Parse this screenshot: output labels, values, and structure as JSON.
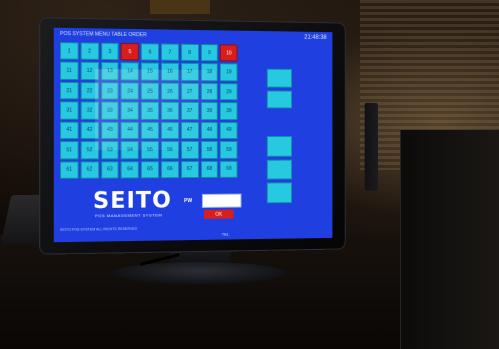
{
  "screen": {
    "topbar_left": "POS SYSTEM  MENU  TABLE  ORDER",
    "topbar_right": "21:48:38",
    "tables": [
      {
        "label": "1",
        "state": "free"
      },
      {
        "label": "2",
        "state": "free"
      },
      {
        "label": "3",
        "state": "free"
      },
      {
        "label": "5",
        "state": "occupied"
      },
      {
        "label": "6",
        "state": "free"
      },
      {
        "label": "7",
        "state": "free"
      },
      {
        "label": "8",
        "state": "free"
      },
      {
        "label": "9",
        "state": "free"
      },
      {
        "label": "10",
        "state": "occupied"
      },
      {
        "label": "",
        "state": "empty"
      },
      {
        "label": "11",
        "state": "free"
      },
      {
        "label": "12",
        "state": "free"
      },
      {
        "label": "13",
        "state": "free"
      },
      {
        "label": "14",
        "state": "free"
      },
      {
        "label": "15",
        "state": "free"
      },
      {
        "label": "16",
        "state": "free"
      },
      {
        "label": "17",
        "state": "free"
      },
      {
        "label": "18",
        "state": "free"
      },
      {
        "label": "19",
        "state": "free"
      },
      {
        "label": "",
        "state": "empty"
      },
      {
        "label": "21",
        "state": "free"
      },
      {
        "label": "22",
        "state": "free"
      },
      {
        "label": "23",
        "state": "free"
      },
      {
        "label": "24",
        "state": "free"
      },
      {
        "label": "25",
        "state": "free"
      },
      {
        "label": "26",
        "state": "free"
      },
      {
        "label": "27",
        "state": "free"
      },
      {
        "label": "28",
        "state": "free"
      },
      {
        "label": "29",
        "state": "free"
      },
      {
        "label": "",
        "state": "empty"
      },
      {
        "label": "31",
        "state": "free"
      },
      {
        "label": "32",
        "state": "free"
      },
      {
        "label": "33",
        "state": "free"
      },
      {
        "label": "34",
        "state": "free"
      },
      {
        "label": "35",
        "state": "free"
      },
      {
        "label": "36",
        "state": "free"
      },
      {
        "label": "37",
        "state": "free"
      },
      {
        "label": "38",
        "state": "free"
      },
      {
        "label": "39",
        "state": "free"
      },
      {
        "label": "",
        "state": "empty"
      },
      {
        "label": "41",
        "state": "free"
      },
      {
        "label": "42",
        "state": "free"
      },
      {
        "label": "43",
        "state": "free"
      },
      {
        "label": "44",
        "state": "free"
      },
      {
        "label": "45",
        "state": "free"
      },
      {
        "label": "46",
        "state": "free"
      },
      {
        "label": "47",
        "state": "free"
      },
      {
        "label": "48",
        "state": "free"
      },
      {
        "label": "49",
        "state": "free"
      },
      {
        "label": "",
        "state": "empty"
      },
      {
        "label": "51",
        "state": "free"
      },
      {
        "label": "52",
        "state": "free"
      },
      {
        "label": "53",
        "state": "free"
      },
      {
        "label": "54",
        "state": "free"
      },
      {
        "label": "55",
        "state": "free"
      },
      {
        "label": "56",
        "state": "free"
      },
      {
        "label": "57",
        "state": "free"
      },
      {
        "label": "58",
        "state": "free"
      },
      {
        "label": "59",
        "state": "free"
      },
      {
        "label": "",
        "state": "empty"
      },
      {
        "label": "61",
        "state": "free"
      },
      {
        "label": "62",
        "state": "free"
      },
      {
        "label": "63",
        "state": "free"
      },
      {
        "label": "64",
        "state": "free"
      },
      {
        "label": "65",
        "state": "free"
      },
      {
        "label": "66",
        "state": "free"
      },
      {
        "label": "67",
        "state": "free"
      },
      {
        "label": "68",
        "state": "free"
      },
      {
        "label": "69",
        "state": "free"
      },
      {
        "label": "",
        "state": "empty"
      }
    ],
    "side_buttons": [
      "",
      ""
    ],
    "side_buttons_lower": [
      "",
      "",
      ""
    ],
    "brand": "SEITO",
    "tagline": "POS MANAGEMENT SYSTEM",
    "login_label": "PW",
    "login_value": "",
    "ok_label": "OK",
    "status_line": "SEITO POS SYSTEM  ALL RIGHTS RESERVED",
    "vendor_line": "TEL"
  },
  "colors": {
    "screen_bg": "#1f3fe0",
    "table_free": "#27c9e0",
    "table_occupied": "#d81d1d"
  }
}
